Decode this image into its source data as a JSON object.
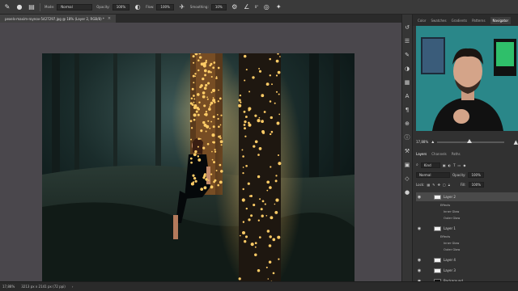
{
  "options_bar": {
    "mode_label": "Mode:",
    "mode_value": "Normal",
    "opacity_label": "Opacity:",
    "opacity_value": "100%",
    "flow_label": "Flow:",
    "flow_value": "100%",
    "smoothing_label": "Smoothing:",
    "smoothing_value": "10%",
    "angle_value": "0°"
  },
  "document": {
    "tab_title": "pexels-maxim-roynov-5427297.jpg @ 18% (Layer 2, RGB/8) *",
    "close_glyph": "×"
  },
  "panel_tabs": [
    "Color",
    "Swatches",
    "Gradients",
    "Patterns",
    "Navigator"
  ],
  "panel_tabs_active": "Navigator",
  "navigator": {
    "zoom_value": "17,88%"
  },
  "layers_panel": {
    "tabs": [
      "Layers",
      "Channels",
      "Paths"
    ],
    "active_tab": "Layers",
    "kind_label": "Kind",
    "blend_mode": "Normal",
    "opacity_label": "Opacity:",
    "opacity_value": "100%",
    "lock_label": "Lock:",
    "fill_label": "Fill:",
    "fill_value": "100%",
    "layers": [
      {
        "name": "Layer 2",
        "effects_label": "Effects",
        "effects": [
          "Inner Glow",
          "Outer Glow"
        ]
      },
      {
        "name": "Layer 1",
        "effects_label": "Effects",
        "effects": [
          "Inner Glow",
          "Outer Glow"
        ]
      },
      {
        "name": "Layer 4"
      },
      {
        "name": "Layer 3"
      },
      {
        "name": "Background"
      }
    ]
  },
  "status_bar": {
    "zoom": "17,88%",
    "doc_info": "3213 px x 2141 px (72 ppi)"
  },
  "colors": {
    "app_bg": "#282828",
    "canvas_bg": "#4a474c",
    "panel_bg": "#313131",
    "webcam_bg": "#2c8a8c",
    "light_glow": "#ffcc66"
  }
}
